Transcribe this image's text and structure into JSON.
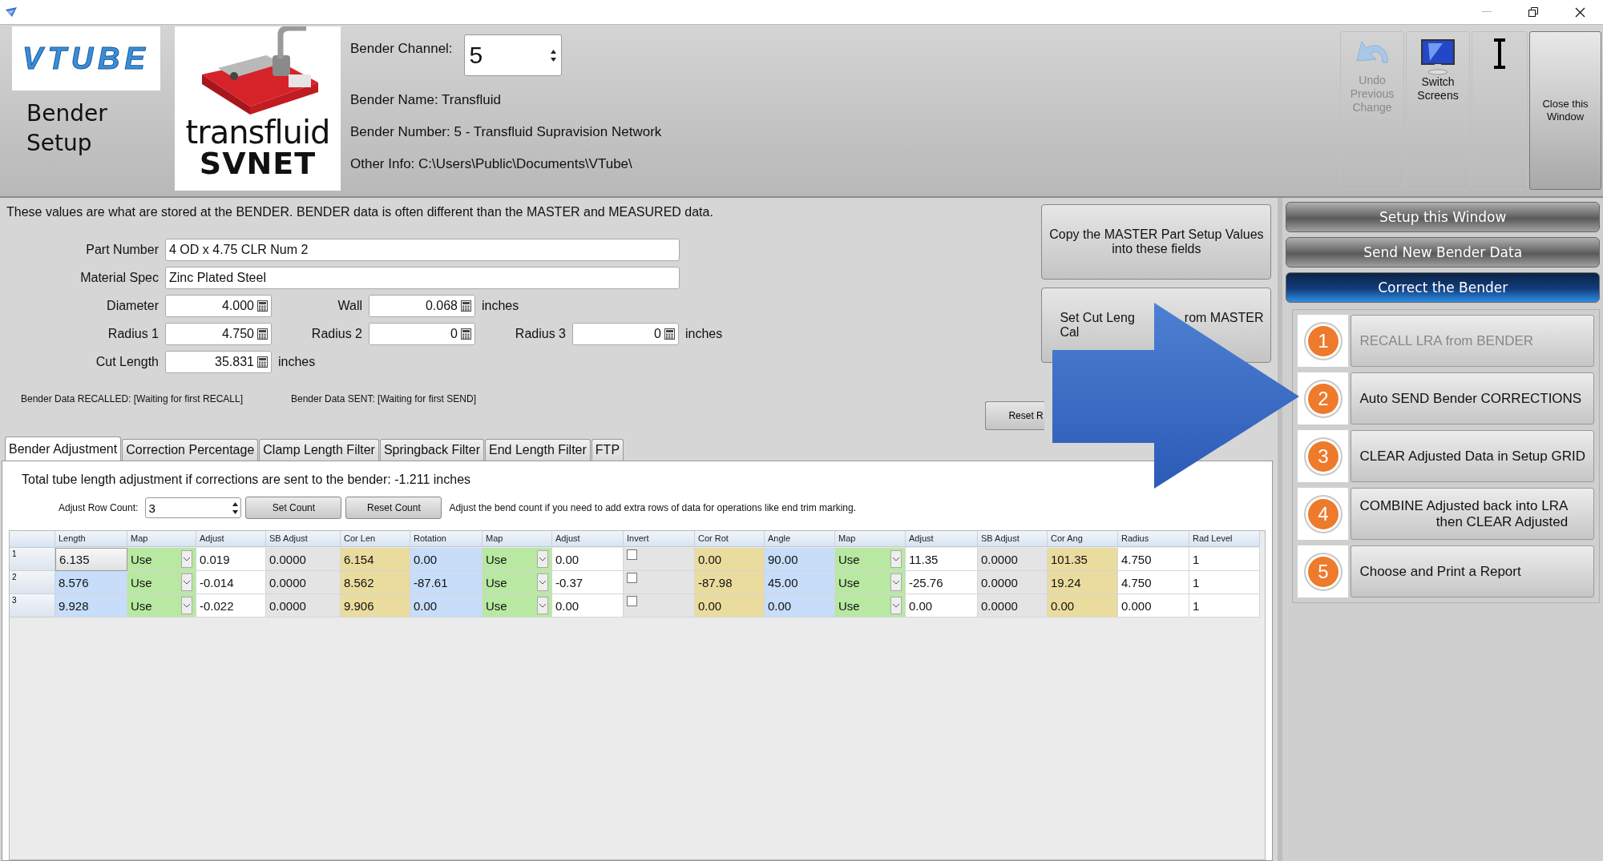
{
  "header": {
    "logo": "VTUBE",
    "title": [
      "Bender",
      "Setup"
    ],
    "brand": {
      "kind": "picture",
      "line_1": "transfluid",
      "line_2": "SVNET"
    },
    "channel": {
      "label": "Bender Channel:",
      "value": "5"
    },
    "info": [
      "Bender Name: Transfluid",
      "Bender Number: 5 - Transfluid Supravision Network",
      "Other Info: C:\\Users\\Public\\Documents\\VTube\\"
    ]
  },
  "toolbar": [
    {
      "kind": "undo",
      "lines": [
        "Undo",
        "Previous",
        "Change"
      ],
      "disabled": true
    },
    {
      "kind": "monitor",
      "lines": [
        "Switch",
        "Screens"
      ],
      "disabled": false
    },
    {
      "kind": "cursor"
    },
    {
      "kind": "plain",
      "lines": [
        "Close this",
        "Window"
      ],
      "disabled": false
    }
  ],
  "notice": "These values are what are stored at the BENDER.  BENDER data is often different than the MASTER and MEASURED data.",
  "text_fields": [
    {
      "label": "Part Number",
      "value": "4 OD x 4.75 CLR Num 2"
    },
    {
      "label": "Material Spec",
      "value": "Zinc Plated Steel"
    }
  ],
  "number_rows": [
    {
      "fields": [
        {
          "label": "Diameter",
          "value": "4.000"
        },
        {
          "label": "Wall",
          "value": "0.068"
        }
      ],
      "unit": "inches"
    },
    {
      "fields": [
        {
          "label": "Radius 1",
          "value": "4.750"
        },
        {
          "label": "Radius 2",
          "value": "0"
        },
        {
          "label": "Radius 3",
          "value": "0"
        }
      ],
      "unit": "inches"
    },
    {
      "fields": [
        {
          "label": "Cut Length",
          "value": "35.831"
        }
      ],
      "unit": "inches"
    }
  ],
  "status": [
    "Bender Data RECALLED: [Waiting for first RECALL]",
    "Bender Data SENT: [Waiting for first SEND]"
  ],
  "actions": [
    {
      "lines": [
        [
          "Copy the MASTER Part Setup Values"
        ],
        [
          "into these fields"
        ]
      ]
    },
    {
      "lines": [
        [
          "Set Cut Leng",
          "rom MASTER"
        ],
        [
          "Cal"
        ]
      ]
    }
  ],
  "reset_button": "Reset R",
  "tabs": [
    {
      "label": "Bender Adjustment",
      "selected": true
    },
    {
      "label": "Correction Percentage",
      "selected": false
    },
    {
      "label": "Clamp Length Filter",
      "selected": false
    },
    {
      "label": "Springback Filter",
      "selected": false
    },
    {
      "label": "End Length Filter",
      "selected": false
    },
    {
      "label": "FTP",
      "selected": false
    }
  ],
  "adjustment": "Total tube length adjustment if corrections are sent to the bender:  -1.211 inches",
  "row_count": {
    "label": "Adjust Row Count:",
    "value": "3",
    "buttons": [
      "Set Count",
      "Reset Count"
    ],
    "hint": "Adjust the bend count if you need to add extra rows of data for operations like end trim marking."
  },
  "grid": {
    "columns": [
      {
        "label": "Length",
        "kind": "input"
      },
      {
        "label": "Map",
        "kind": "map"
      },
      {
        "label": "Adjust",
        "kind": "plain"
      },
      {
        "label": "SB Adjust",
        "kind": "fixed"
      },
      {
        "label": "Cor Len",
        "kind": "result"
      },
      {
        "label": "Rotation",
        "kind": "input"
      },
      {
        "label": "Map",
        "kind": "map"
      },
      {
        "label": "Adjust",
        "kind": "plain"
      },
      {
        "label": "Invert",
        "kind": "check"
      },
      {
        "label": "Cor Rot",
        "kind": "result"
      },
      {
        "label": "Angle",
        "kind": "input"
      },
      {
        "label": "Map",
        "kind": "map"
      },
      {
        "label": "Adjust",
        "kind": "plain"
      },
      {
        "label": "SB Adjust",
        "kind": "fixed"
      },
      {
        "label": "Cor Ang",
        "kind": "result"
      },
      {
        "label": "Radius",
        "kind": "plain"
      },
      {
        "label": "Rad Level",
        "kind": "plain"
      }
    ],
    "rows": [
      {
        "number": "1",
        "selected": true,
        "cells": [
          "6.135",
          "Use",
          "0.019",
          "0.0000",
          "6.154",
          "0.00",
          "Use",
          "0.00",
          {
            "checked": false
          },
          "0.00",
          "90.00",
          "Use",
          "11.35",
          "0.0000",
          "101.35",
          "4.750",
          "1"
        ]
      },
      {
        "number": "2",
        "selected": false,
        "cells": [
          "8.576",
          "Use",
          "-0.014",
          "0.0000",
          "8.562",
          "-87.61",
          "Use",
          "-0.37",
          {
            "checked": false
          },
          "-87.98",
          "45.00",
          "Use",
          "-25.76",
          "0.0000",
          "19.24",
          "4.750",
          "1"
        ]
      },
      {
        "number": "3",
        "selected": false,
        "cells": [
          "9.928",
          "Use",
          "-0.022",
          "0.0000",
          "9.906",
          "0.00",
          "Use",
          "0.00",
          {
            "checked": false
          },
          "0.00",
          "0.00",
          "Use",
          "0.00",
          "0.0000",
          "0.00",
          "0.000",
          "1"
        ]
      }
    ]
  },
  "nav": [
    {
      "label": "Setup this Window",
      "selected": false
    },
    {
      "label": "Send New Bender Data",
      "selected": false
    },
    {
      "label": "Correct the Bender",
      "selected": true
    }
  ],
  "steps": [
    {
      "number": "1",
      "lines": [
        "RECALL LRA from BENDER"
      ],
      "disabled": true
    },
    {
      "number": "2",
      "lines": [
        "Auto SEND Bender CORRECTIONS"
      ],
      "disabled": false
    },
    {
      "number": "3",
      "lines": [
        "CLEAR Adjusted Data in Setup GRID"
      ],
      "disabled": false
    },
    {
      "number": "4",
      "lines": [
        "COMBINE Adjusted back into LRA",
        "then CLEAR Adjusted"
      ],
      "disabled": false
    },
    {
      "number": "5",
      "lines": [
        "Choose and Print a Report"
      ],
      "disabled": false
    }
  ],
  "overlay": {
    "kind": "arrow"
  }
}
